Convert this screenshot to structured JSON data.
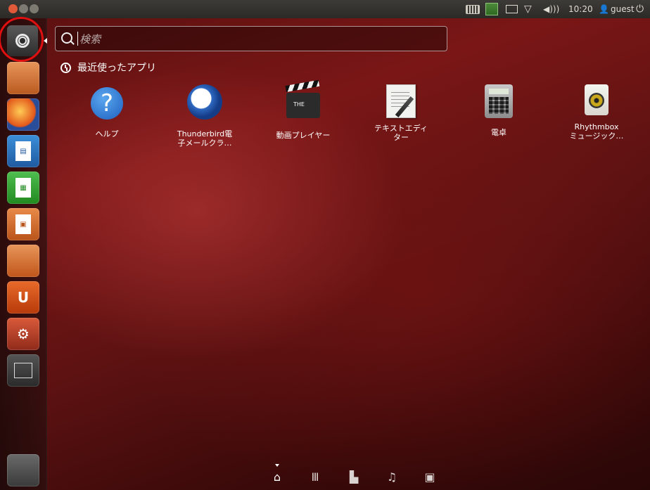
{
  "window_controls": {
    "close": "close",
    "minimize": "minimize",
    "maximize": "maximize"
  },
  "panel": {
    "clock": "10:20",
    "user": "guest",
    "volume_glyph": "◀)))",
    "wifi_glyph": "▽",
    "user_glyph": "👤",
    "session_glyph": "⏻"
  },
  "launcher": {
    "items": [
      {
        "name": "dash-home",
        "color": "#3a3a3a"
      },
      {
        "name": "files",
        "color": "#d9773a"
      },
      {
        "name": "firefox",
        "color": "#e35a1a"
      },
      {
        "name": "writer",
        "color": "#2d7fc9"
      },
      {
        "name": "calc",
        "color": "#3aa03a"
      },
      {
        "name": "impress",
        "color": "#d96a2a"
      },
      {
        "name": "software-center",
        "color": "#d96a2a"
      },
      {
        "name": "ubuntu-one",
        "color": "#d9541a"
      },
      {
        "name": "system-settings",
        "color": "#b7412f"
      },
      {
        "name": "workspace-switcher",
        "color": "#3a3a3a"
      },
      {
        "name": "trash",
        "color": "#8a8a8a"
      }
    ]
  },
  "search": {
    "placeholder": "検索"
  },
  "recent": {
    "title": "最近使ったアプリ",
    "apps": [
      {
        "label": "ヘルプ"
      },
      {
        "label": "Thunderbird電\n子メールクラ…"
      },
      {
        "label": "動画プレイヤー"
      },
      {
        "label": "テキストエディ\nター"
      },
      {
        "label": "電卓"
      },
      {
        "label": "Rhythmbox\nミュージック…"
      }
    ]
  },
  "clapper_text": "THE",
  "lenses": {
    "home": "⌂",
    "apps": "Ⅲ",
    "files": "▙",
    "music": "♫",
    "video": "▣"
  }
}
